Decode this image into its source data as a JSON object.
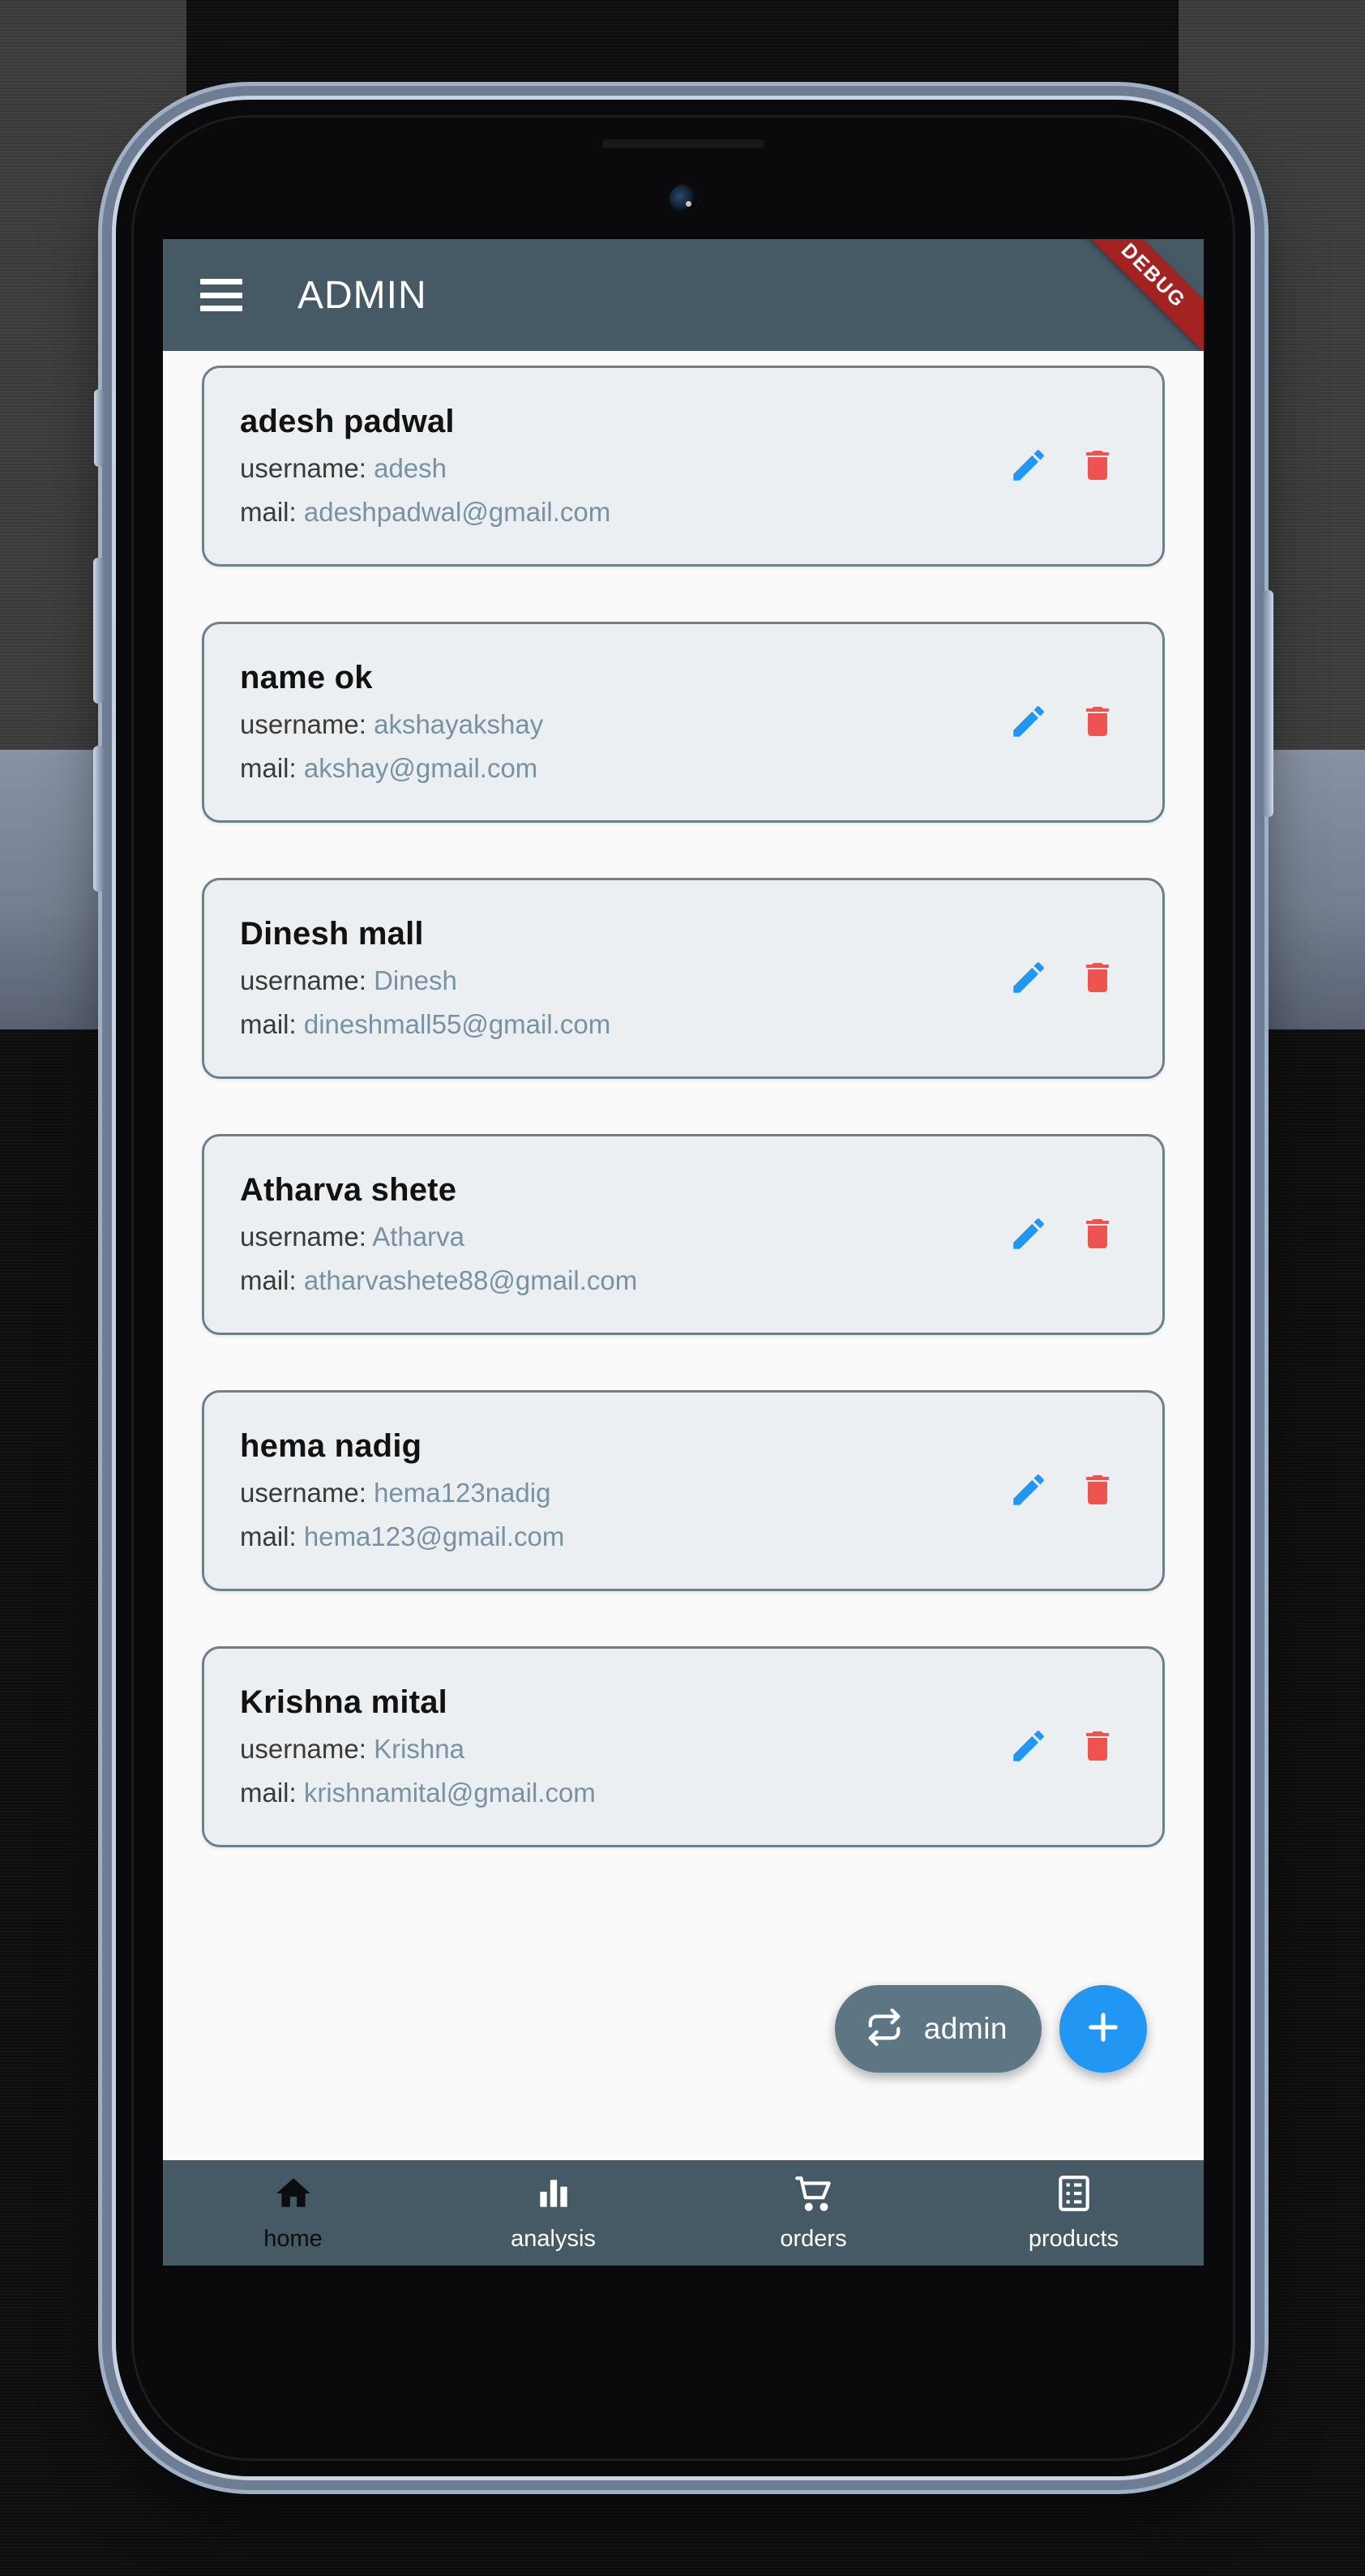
{
  "appbar": {
    "menu_icon": "hamburger-menu-icon",
    "title": "ADMIN",
    "debug_ribbon": "DEBUG",
    "background_color": "#455A64"
  },
  "colors": {
    "appbar": "#455A64",
    "card_bg": "#ECEFF1",
    "card_border": "#6b818c",
    "screen_bg": "#FAFAFA",
    "edit_icon": "#2196F3",
    "delete_icon": "#EF5350",
    "fab_extended": "#5d7683",
    "fab_round": "#2196F3",
    "value_text": "#7793a3"
  },
  "list": {
    "username_label": "username:",
    "mail_label": "mail:",
    "users": [
      {
        "name": "adesh padwal",
        "username": "adesh",
        "mail": "adeshpadwal@gmail.com"
      },
      {
        "name": "name ok",
        "username": "akshayakshay",
        "mail": "akshay@gmail.com"
      },
      {
        "name": "Dinesh mall",
        "username": "Dinesh",
        "mail": "dineshmall55@gmail.com"
      },
      {
        "name": "Atharva shete",
        "username": "Atharva",
        "mail": "atharvashete88@gmail.com"
      },
      {
        "name": "hema nadig",
        "username": "hema123nadig",
        "mail": "hema123@gmail.com"
      },
      {
        "name": "Krishna mital",
        "username": "Krishna",
        "mail": "krishnamital@gmail.com"
      }
    ]
  },
  "fabs": {
    "extended_label": "admin",
    "extended_icon": "swap-repeat-icon",
    "round_icon": "plus-icon"
  },
  "bottomnav": {
    "items": [
      {
        "label": "home",
        "icon": "home-icon",
        "active": true
      },
      {
        "label": "analysis",
        "icon": "bar-chart-icon",
        "active": false
      },
      {
        "label": "orders",
        "icon": "shopping-cart-icon",
        "active": false
      },
      {
        "label": "products",
        "icon": "list-grid-icon",
        "active": false
      }
    ]
  }
}
